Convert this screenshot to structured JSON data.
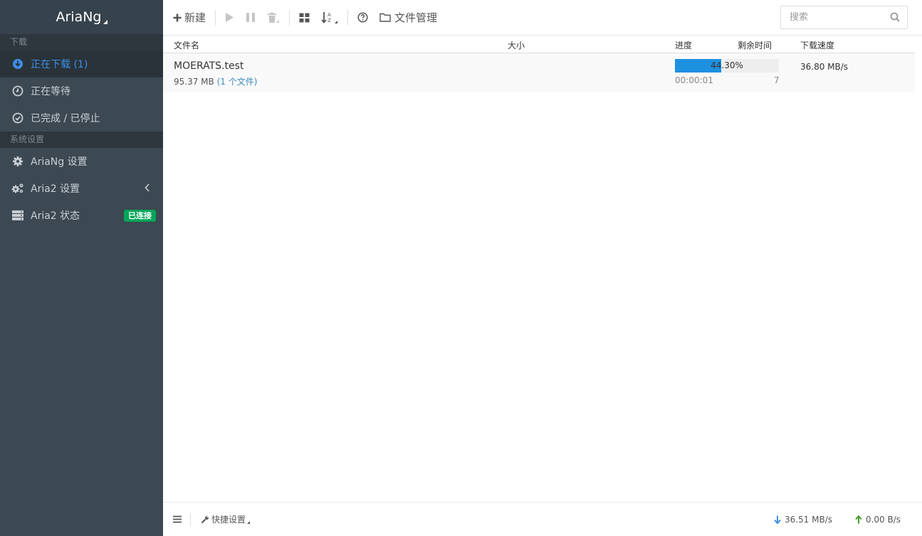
{
  "sidebar": {
    "brand": "AriaNg",
    "section_download": "下载",
    "items_download": [
      {
        "label": "正在下载 (1)",
        "icon": "download-circle-icon"
      },
      {
        "label": "正在等待",
        "icon": "clock-icon"
      },
      {
        "label": "已完成 / 已停止",
        "icon": "check-circle-icon"
      }
    ],
    "section_settings": "系统设置",
    "items_settings": [
      {
        "label": "AriaNg 设置",
        "icon": "gear-icon"
      },
      {
        "label": "Aria2 设置",
        "icon": "gears-icon"
      },
      {
        "label": "Aria2 状态",
        "icon": "server-icon",
        "badge": "已连接"
      }
    ]
  },
  "toolbar": {
    "new_label": "新建",
    "file_manager_label": "文件管理"
  },
  "search": {
    "placeholder": "搜索"
  },
  "table": {
    "columns": [
      "文件名",
      "大小",
      "进度",
      "剩余时间",
      "下载速度"
    ],
    "rows": [
      {
        "name": "MOERATS.test",
        "size": "95.37 MB",
        "files": "(1 个文件)",
        "progress": 44.3,
        "progress_text": "44.30%",
        "elapsed": "00:00:01",
        "connections": "7",
        "speed": "36.80 MB/s"
      }
    ]
  },
  "footer": {
    "quick_settings": "快捷设置",
    "download_speed": "36.51 MB/s",
    "upload_speed": "0.00 B/s"
  },
  "colors": {
    "sidebar_bg": "#3c4852",
    "accent": "#3e8ee8",
    "progress": "#1e90e0",
    "badge": "#00a65a"
  }
}
